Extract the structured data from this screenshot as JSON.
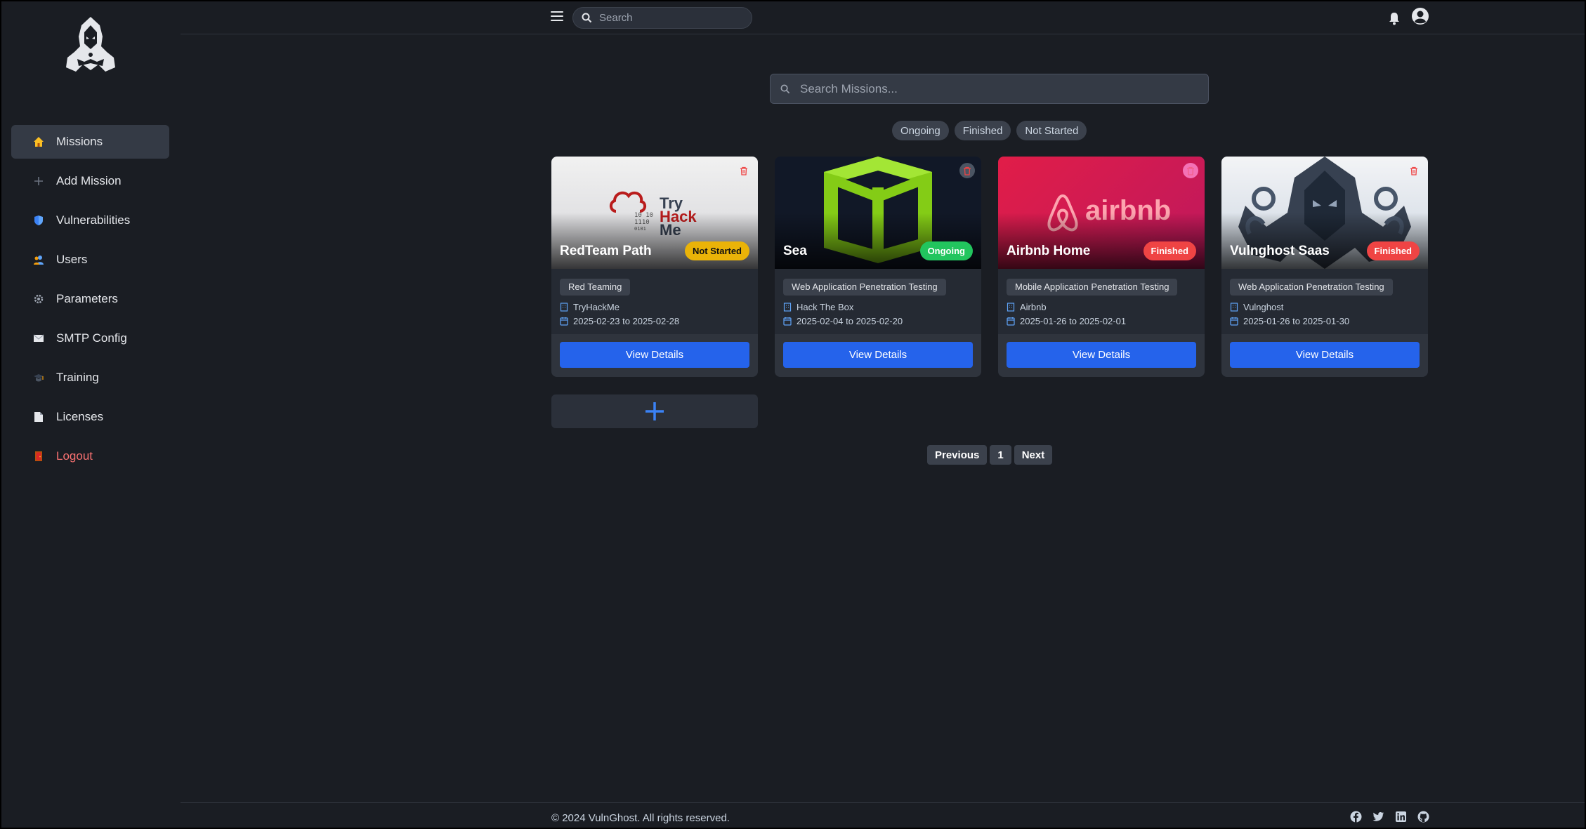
{
  "topbar": {
    "search_placeholder": "Search"
  },
  "sidebar": {
    "items": [
      {
        "label": "Missions",
        "icon": "home-icon",
        "active": true
      },
      {
        "label": "Add Mission",
        "icon": "plus-icon"
      },
      {
        "label": "Vulnerabilities",
        "icon": "shield-icon"
      },
      {
        "label": "Users",
        "icon": "users-icon"
      },
      {
        "label": "Parameters",
        "icon": "gear-icon"
      },
      {
        "label": "SMTP Config",
        "icon": "mail-icon"
      },
      {
        "label": "Training",
        "icon": "graduation-cap-icon"
      },
      {
        "label": "Licenses",
        "icon": "document-icon"
      },
      {
        "label": "Logout",
        "icon": "door-icon"
      }
    ]
  },
  "main": {
    "search_placeholder": "Search Missions...",
    "filters": [
      "Ongoing",
      "Finished",
      "Not Started"
    ],
    "missions": [
      {
        "title": "RedTeam Path",
        "status": "Not Started",
        "category": "Red Teaming",
        "client": "TryHackMe",
        "dates": "2025-02-23 to 2025-02-28",
        "button": "View Details",
        "image_text": [
          "Try",
          "Hack",
          "Me"
        ]
      },
      {
        "title": "Sea",
        "status": "Ongoing",
        "category": "Web Application Penetration Testing",
        "client": "Hack The Box",
        "dates": "2025-02-04 to 2025-02-20",
        "button": "View Details"
      },
      {
        "title": "Airbnb Home",
        "status": "Finished",
        "category": "Mobile Application Penetration Testing",
        "client": "Airbnb",
        "dates": "2025-01-26 to 2025-02-01",
        "button": "View Details",
        "image_text": [
          "airbnb"
        ]
      },
      {
        "title": "Vulnghost Saas",
        "status": "Finished",
        "category": "Web Application Penetration Testing",
        "client": "Vulnghost",
        "dates": "2025-01-26 to 2025-01-30",
        "button": "View Details"
      }
    ],
    "pagination": {
      "previous": "Previous",
      "page": "1",
      "next": "Next"
    }
  },
  "footer": {
    "copyright": "© 2024 VulnGhost. All rights reserved.",
    "socials": [
      "facebook-icon",
      "twitter-icon",
      "linkedin-icon",
      "github-icon"
    ]
  },
  "colors": {
    "accent": "#2563eb",
    "not_started": "#eab308",
    "ongoing": "#22c55e",
    "finished": "#ef4444"
  }
}
